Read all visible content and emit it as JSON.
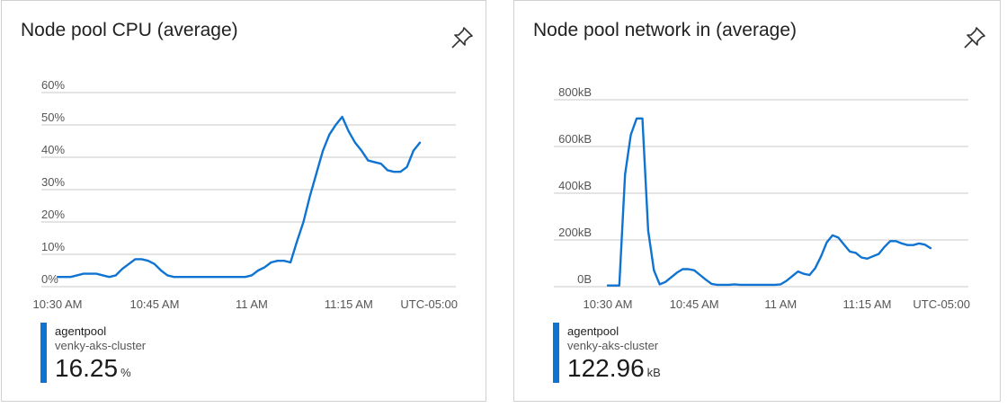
{
  "colors": {
    "series": "#0f74d1",
    "grid": "#c8c8c8",
    "text": "#555555"
  },
  "cards": [
    {
      "title": "Node pool CPU (average)",
      "pin_icon": "pin-icon",
      "legend": {
        "series": "agentpool",
        "resource": "venky-aks-cluster",
        "value": "16.25",
        "unit": "%"
      },
      "chart_data": {
        "type": "line",
        "title": "Node pool CPU (average)",
        "timezone_label": "UTC-05:00",
        "x_ticks": [
          "10:30 AM",
          "10:45 AM",
          "11 AM",
          "11:15 AM"
        ],
        "x_tick_minutes": [
          0,
          15,
          30,
          45
        ],
        "y_ticks": [
          "0%",
          "10%",
          "20%",
          "30%",
          "40%",
          "50%",
          "60%"
        ],
        "ylim": [
          0,
          60
        ],
        "grid": true,
        "series": [
          {
            "name": "agentpool",
            "x_minutes": [
              0,
              1,
              2,
              3,
              4,
              5,
              6,
              7,
              8,
              9,
              10,
              11,
              12,
              13,
              14,
              15,
              16,
              17,
              18,
              19,
              20,
              21,
              22,
              23,
              24,
              25,
              26,
              27,
              28,
              29,
              30,
              31,
              32,
              33,
              34,
              35,
              36,
              37,
              38,
              39,
              40,
              41,
              42,
              43,
              44,
              45,
              46,
              47,
              48,
              49,
              50,
              51,
              52,
              53,
              54,
              55,
              56
            ],
            "values": [
              3,
              3,
              3,
              3.5,
              4,
              4,
              4,
              3.5,
              3,
              3.5,
              5.5,
              7,
              8.5,
              8.5,
              8,
              7,
              5,
              3.5,
              3,
              3,
              3,
              3,
              3,
              3,
              3,
              3,
              3,
              3,
              3,
              3,
              3.5,
              5,
              6,
              7.5,
              8,
              8,
              7.5,
              14,
              20,
              28,
              35,
              42,
              47,
              50,
              52.5,
              48,
              44.5,
              42,
              39,
              38.5,
              38,
              36,
              35.5,
              35.5,
              37,
              42,
              44.5
            ]
          }
        ]
      }
    },
    {
      "title": "Node pool network in (average)",
      "pin_icon": "pin-icon",
      "legend": {
        "series": "agentpool",
        "resource": "venky-aks-cluster",
        "value": "122.96",
        "unit": "kB"
      },
      "chart_data": {
        "type": "line",
        "title": "Node pool network in (average)",
        "timezone_label": "UTC-05:00",
        "x_ticks": [
          "10:30 AM",
          "10:45 AM",
          "11 AM",
          "11:15 AM"
        ],
        "x_tick_minutes": [
          0,
          15,
          30,
          45
        ],
        "y_ticks": [
          "0B",
          "200kB",
          "400kB",
          "600kB",
          "800kB"
        ],
        "ylim": [
          0,
          800
        ],
        "grid": true,
        "series": [
          {
            "name": "agentpool",
            "x_minutes": [
              0,
              1,
              2,
              3,
              4,
              5,
              6,
              7,
              8,
              9,
              10,
              11,
              12,
              13,
              14,
              15,
              16,
              17,
              18,
              19,
              20,
              21,
              22,
              23,
              24,
              25,
              26,
              27,
              28,
              29,
              30,
              31,
              32,
              33,
              34,
              35,
              36,
              37,
              38,
              39,
              40,
              41,
              42,
              43,
              44,
              45,
              46,
              47,
              48,
              49,
              50,
              51,
              52,
              53,
              54,
              55,
              56
            ],
            "values": [
              5,
              5,
              5,
              480,
              650,
              720,
              720,
              240,
              70,
              10,
              20,
              40,
              60,
              75,
              75,
              70,
              50,
              30,
              12,
              8,
              8,
              8,
              10,
              8,
              8,
              8,
              8,
              8,
              8,
              8,
              10,
              25,
              45,
              65,
              55,
              50,
              80,
              130,
              190,
              220,
              210,
              180,
              150,
              145,
              125,
              120,
              130,
              140,
              170,
              195,
              195,
              185,
              178,
              178,
              185,
              180,
              165
            ]
          }
        ]
      }
    }
  ]
}
